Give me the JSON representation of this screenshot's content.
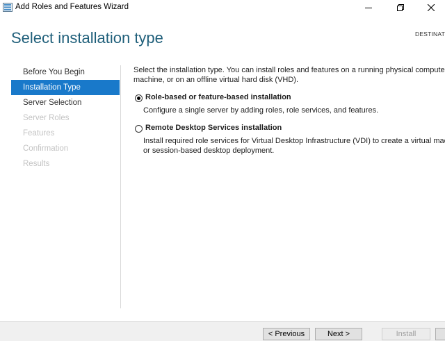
{
  "window": {
    "title": "Add Roles and Features Wizard",
    "icons": {
      "app": "server-manager-icon",
      "minimize": "minimize-icon",
      "maximize": "maximize-icon",
      "close": "close-icon"
    }
  },
  "header": {
    "title": "Select installation type",
    "destination_label": "DESTINATI"
  },
  "nav": {
    "items": [
      {
        "label": "Before You Begin",
        "state": "done"
      },
      {
        "label": "Installation Type",
        "state": "active"
      },
      {
        "label": "Server Selection",
        "state": "done"
      },
      {
        "label": "Server Roles",
        "state": "disabled"
      },
      {
        "label": "Features",
        "state": "disabled"
      },
      {
        "label": "Confirmation",
        "state": "disabled"
      },
      {
        "label": "Results",
        "state": "disabled"
      }
    ]
  },
  "content": {
    "intro_line1": "Select the installation type. You can install roles and features on a running physical computer",
    "intro_line2": "machine, or on an offline virtual hard disk (VHD).",
    "options": [
      {
        "label": "Role-based or feature-based installation",
        "description_line1": "Configure a single server by adding roles, role services, and features.",
        "description_line2": "",
        "selected": true
      },
      {
        "label": "Remote Desktop Services installation",
        "description_line1": "Install required role services for Virtual Desktop Infrastructure (VDI) to create a virtual mac",
        "description_line2": "or session-based desktop deployment.",
        "selected": false
      }
    ]
  },
  "footer": {
    "previous_label": "< Previous",
    "next_label": "Next >",
    "install_label": "Install",
    "cancel_label": ""
  },
  "colors": {
    "title": "#1f5f7a",
    "nav_active_bg": "#1979ca",
    "nav_disabled_text": "#c3c3c3"
  }
}
